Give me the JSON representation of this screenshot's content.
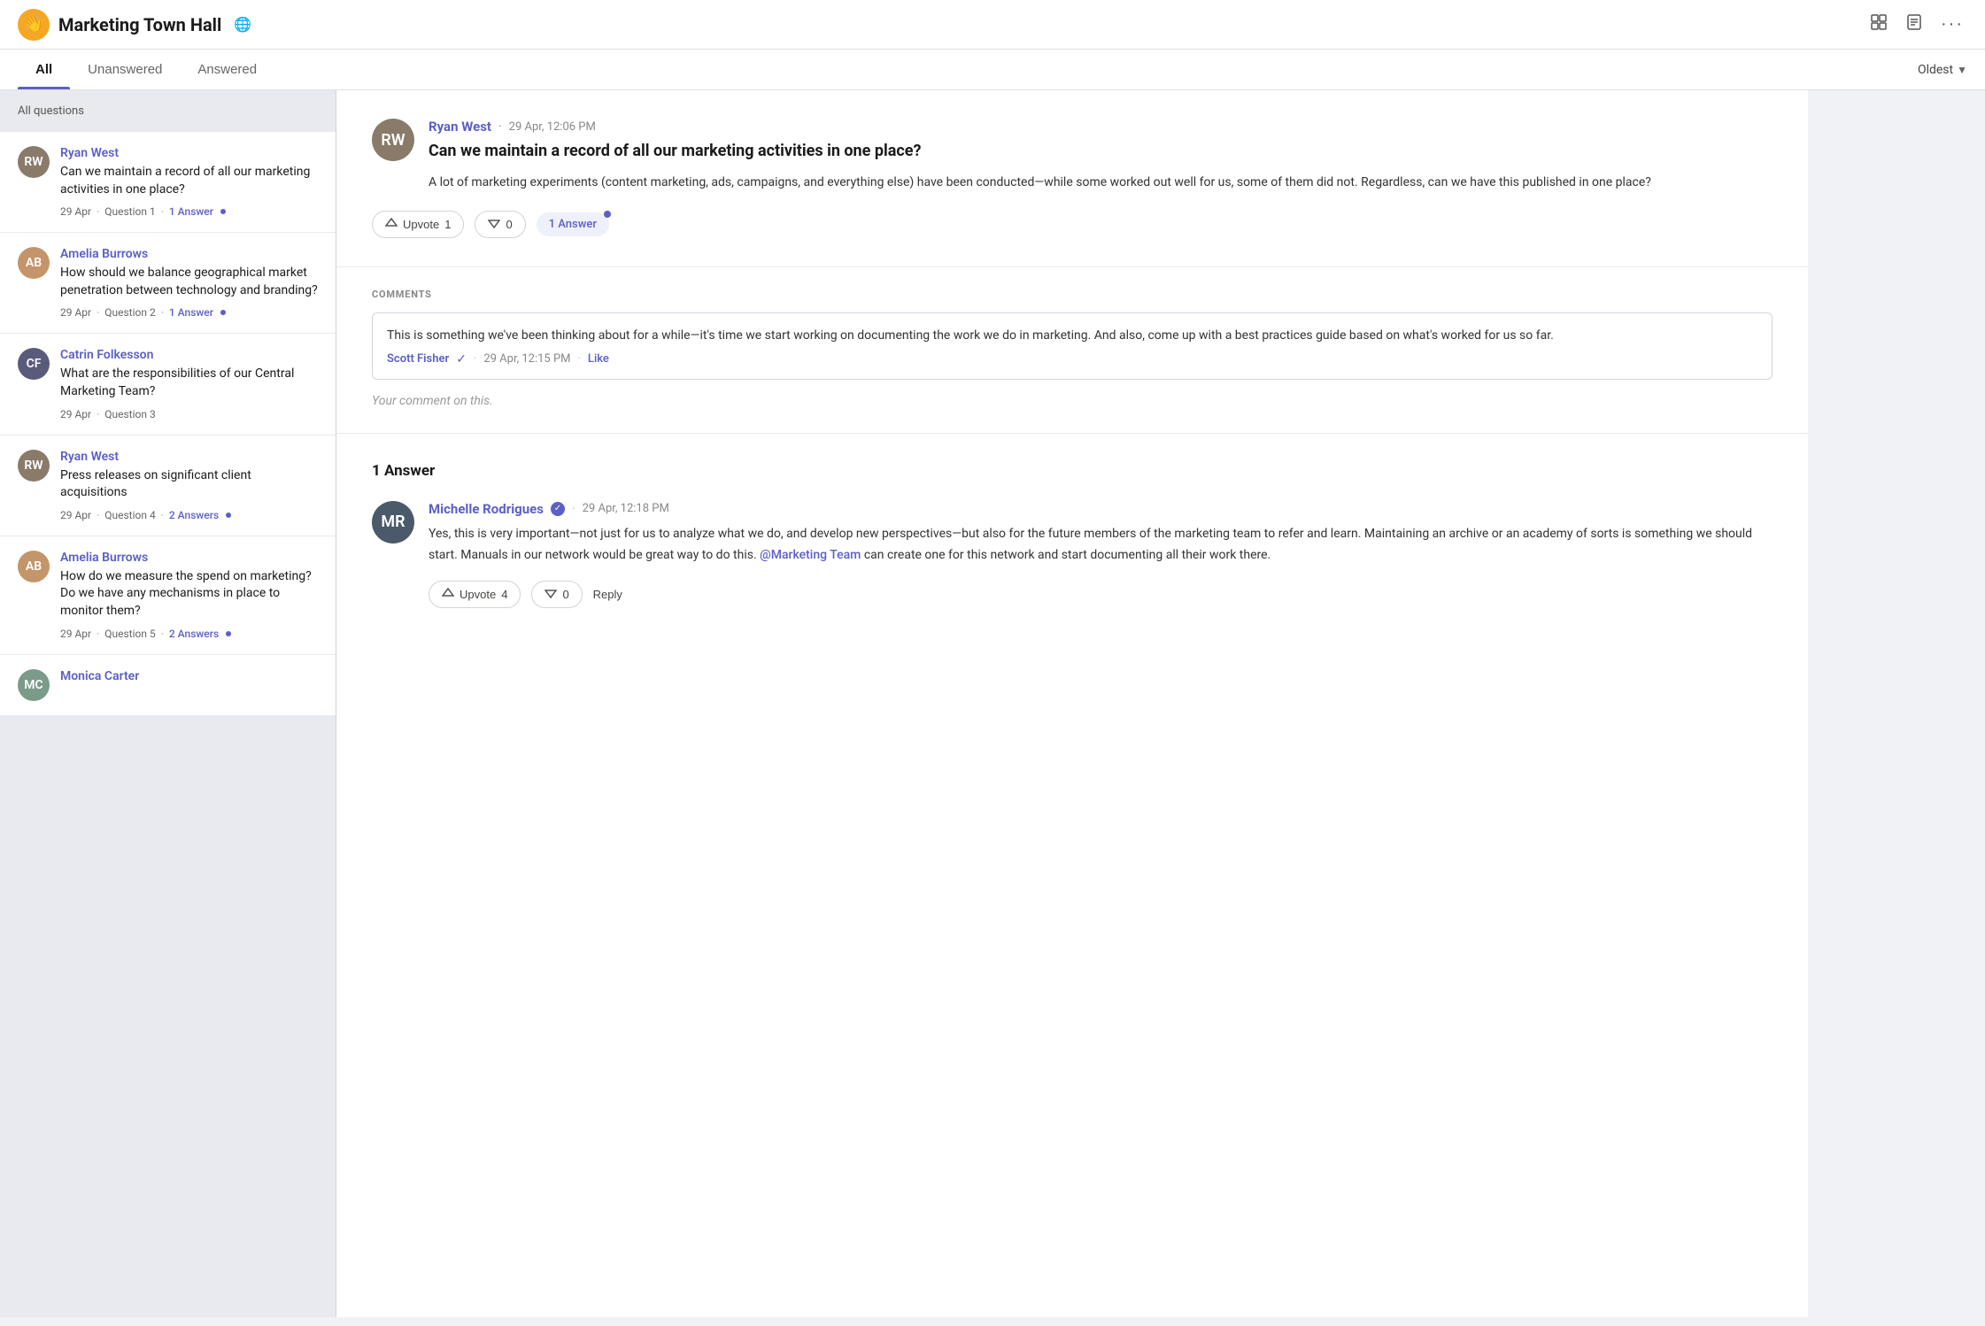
{
  "header": {
    "icon_text": "👋",
    "title": "Marketing Town Hall",
    "globe_icon": "🌐",
    "action_icons": [
      "grid_icon",
      "doc_icon",
      "more_icon"
    ]
  },
  "tabs": {
    "items": [
      {
        "id": "all",
        "label": "All",
        "active": true
      },
      {
        "id": "unanswered",
        "label": "Unanswered",
        "active": false
      },
      {
        "id": "answered",
        "label": "Answered",
        "active": false
      }
    ],
    "sort_label": "Oldest",
    "sort_icon": "▼"
  },
  "sidebar": {
    "header": "All questions",
    "questions": [
      {
        "id": 1,
        "author": "Ryan West",
        "avatar_initials": "RW",
        "avatar_class": "av-ryan",
        "text": "Can we maintain a record of all our marketing activities in one place?",
        "date": "29 Apr",
        "question_num": "Question 1",
        "answers": "1 Answer",
        "has_dot": true
      },
      {
        "id": 2,
        "author": "Amelia Burrows",
        "avatar_initials": "AB",
        "avatar_class": "av-amelia",
        "text": "How should we balance geographical market penetration between technology and branding?",
        "date": "29 Apr",
        "question_num": "Question 2",
        "answers": "1 Answer",
        "has_dot": true
      },
      {
        "id": 3,
        "author": "Catrin Folkesson",
        "avatar_initials": "CF",
        "avatar_class": "av-catrin",
        "text": "What are the responsibilities of our Central Marketing Team?",
        "date": "29 Apr",
        "question_num": "Question 3",
        "answers": "",
        "has_dot": false
      },
      {
        "id": 4,
        "author": "Ryan West",
        "avatar_initials": "RW",
        "avatar_class": "av-ryan",
        "text": "Press releases on significant client acquisitions",
        "date": "29 Apr",
        "question_num": "Question 4",
        "answers": "2 Answers",
        "has_dot": true
      },
      {
        "id": 5,
        "author": "Amelia Burrows",
        "avatar_initials": "AB",
        "avatar_class": "av-amelia",
        "text": "How do we measure the spend on marketing? Do we have any mechanisms in place to monitor them?",
        "date": "29 Apr",
        "question_num": "Question 5",
        "answers": "2 Answers",
        "has_dot": true
      },
      {
        "id": 6,
        "author": "Monica Carter",
        "avatar_initials": "MC",
        "avatar_class": "av-monica",
        "text": "",
        "date": "",
        "question_num": "",
        "answers": "",
        "has_dot": false
      }
    ]
  },
  "detail": {
    "author": "Ryan West",
    "timestamp": "29 Apr, 12:06 PM",
    "title": "Can we maintain a record of all our marketing activities in one place?",
    "body": "A lot of marketing experiments (content marketing, ads, campaigns, and everything else) have been conducted—while some worked out well for us, some of them did not. Regardless, can we have this published in one place?",
    "upvote_label": "Upvote",
    "upvote_count": "1",
    "downvote_count": "0",
    "answer_count_label": "1 Answer"
  },
  "comments": {
    "label": "COMMENTS",
    "items": [
      {
        "text": "This is something we've been thinking about for a while—it's time we start working on documenting the work we do in marketing. And also, come up with a best practices guide based on what's worked for us so far.",
        "author": "Scott Fisher",
        "verified": true,
        "timestamp": "29 Apr, 12:15 PM",
        "like_label": "Like"
      }
    ],
    "placeholder": "Your comment on this."
  },
  "answers": {
    "section_title": "1 Answer",
    "items": [
      {
        "author": "Michelle Rodrigues",
        "verified": true,
        "timestamp": "29 Apr, 12:18 PM",
        "text": "Yes, this is very important—not just for us to analyze what we do, and develop new perspectives—but also for the future members of the marketing team to refer and learn. Maintaining an archive or an academy of sorts is something we should start. Manuals in our network would be great way to do this.",
        "mention": "@Marketing Team",
        "text_after": "can create one for this network and start documenting all their work there.",
        "upvote_label": "Upvote",
        "upvote_count": "4",
        "downvote_count": "0",
        "reply_label": "Reply"
      }
    ]
  }
}
